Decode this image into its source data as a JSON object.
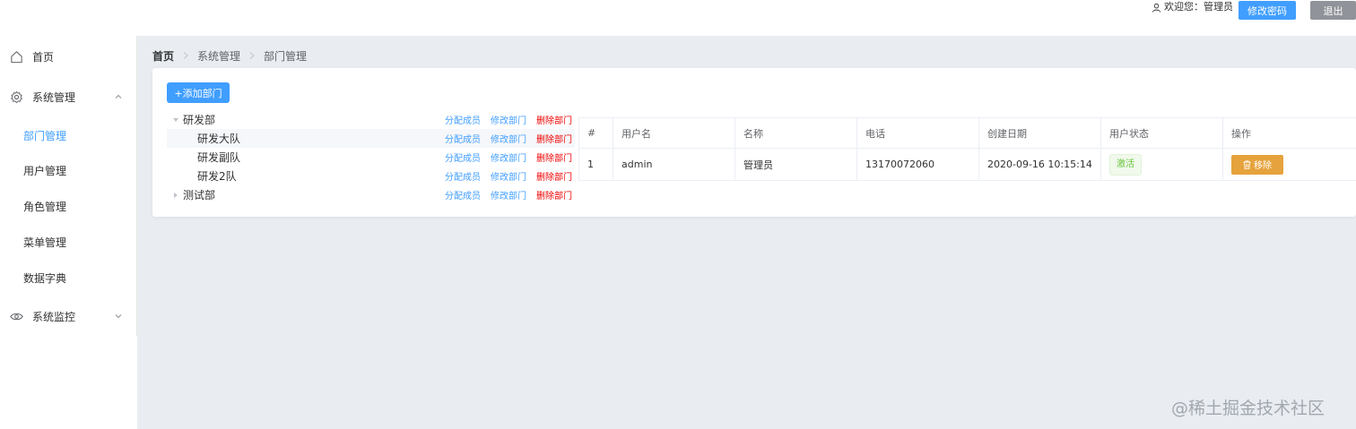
{
  "header": {
    "welcome_text": "欢迎您：管理员",
    "change_password": "修改密码",
    "logout": "退出"
  },
  "sidebar": {
    "items": [
      {
        "label": "首页",
        "icon": "home-icon"
      },
      {
        "label": "系统管理",
        "icon": "gear-icon",
        "expanded": true,
        "children": [
          {
            "label": "部门管理",
            "active": true
          },
          {
            "label": "用户管理"
          },
          {
            "label": "角色管理"
          },
          {
            "label": "菜单管理"
          },
          {
            "label": "数据字典"
          }
        ]
      },
      {
        "label": "系统监控",
        "icon": "eye-icon",
        "expanded": false
      }
    ]
  },
  "breadcrumb": [
    "首页",
    "系统管理",
    "部门管理"
  ],
  "toolbar": {
    "add_department": "+添加部门"
  },
  "tree": {
    "actions": {
      "assign": "分配成员",
      "edit": "修改部门",
      "delete": "删除部门"
    },
    "nodes": [
      {
        "label": "研发部",
        "level": 0,
        "expanded": true
      },
      {
        "label": "研发大队",
        "level": 1,
        "highlighted": true
      },
      {
        "label": "研发副队",
        "level": 1
      },
      {
        "label": "研发2队",
        "level": 1
      },
      {
        "label": "测试部",
        "level": 0,
        "expanded": false
      }
    ]
  },
  "table": {
    "columns": [
      "#",
      "用户名",
      "名称",
      "电话",
      "创建日期",
      "用户状态",
      "操作"
    ],
    "rows": [
      {
        "index": "1",
        "username": "admin",
        "name": "管理员",
        "phone": "13170072060",
        "created": "2020-09-16 10:15:14",
        "status": "激活",
        "action": "移除"
      }
    ]
  },
  "watermark": "@稀土掘金技术社区",
  "colors": {
    "primary": "#409eff",
    "danger": "#f00000",
    "warning": "#e6a23c",
    "success": "#67c23a",
    "info": "#909399"
  }
}
